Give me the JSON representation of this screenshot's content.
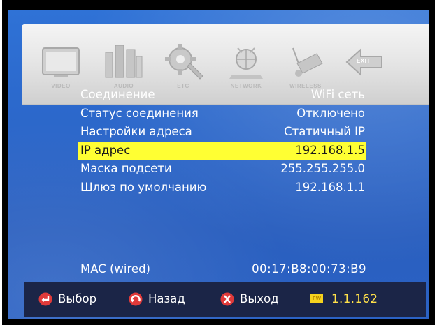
{
  "menu": {
    "items": [
      {
        "label": "VIDEO",
        "icon": "tv-icon"
      },
      {
        "label": "AUDIO",
        "icon": "speakers-icon"
      },
      {
        "label": "ETC",
        "icon": "gear-wrench-icon"
      },
      {
        "label": "NETWORK",
        "icon": "network-globe-icon"
      },
      {
        "label": "WIRELESS",
        "icon": "wireless-icon"
      },
      {
        "label": "EXIT",
        "icon": "exit-arrow-icon"
      }
    ]
  },
  "settings": {
    "rows": [
      {
        "key": "Соединение",
        "value": "WiFi сеть",
        "selected": false
      },
      {
        "key": "Статус соединения",
        "value": "Отключено",
        "selected": false
      },
      {
        "key": "Настройки адреса",
        "value": "Статичный IP",
        "selected": false
      },
      {
        "key": "IP адрес",
        "value": "192.168.1.5",
        "selected": true
      },
      {
        "key": "Маска подсети",
        "value": "255.255.255.0",
        "selected": false
      },
      {
        "key": "Шлюз по умолчанию",
        "value": "192.168.1.1",
        "selected": false
      }
    ],
    "mac_label": "MAC (wired)",
    "mac_value": "00:17:B8:00:73:B9"
  },
  "footer": {
    "select_label": "Выбор",
    "back_label": "Назад",
    "exit_label": "Выход",
    "fw_badge": "FW",
    "fw_version": "1.1.162"
  },
  "colors": {
    "background": "#2b66c9",
    "selected_row": "#ffff33",
    "footer_bg": "#1b2547",
    "fw_text": "#ffe14a",
    "button_red": "#e03a3a"
  }
}
